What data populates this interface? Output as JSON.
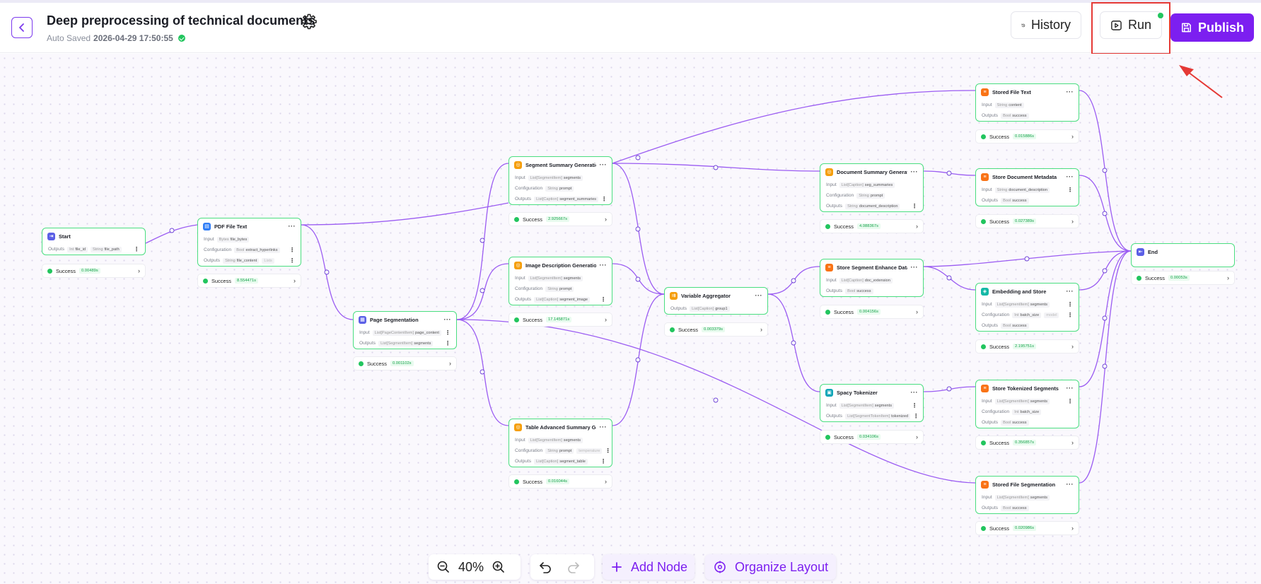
{
  "header": {
    "title": "Deep preprocessing of technical documents",
    "auto_saved_label": "Auto Saved",
    "auto_saved_time": "2026-04-29 17:50:55",
    "history_label": "History",
    "run_label": "Run",
    "publish_label": "Publish"
  },
  "labels": {
    "input": "Input",
    "outputs": "Outputs",
    "configuration": "Configuration",
    "success": "Success"
  },
  "nodes": {
    "start": {
      "title": "Start",
      "out1_type": "Int",
      "out1": "file_id",
      "out2_type": "String",
      "out2": "file_path",
      "duration": "0.00489s"
    },
    "pdf": {
      "title": "PDF File Text",
      "in_type": "Bytes",
      "in": "file_bytes",
      "cfg_type": "Bool",
      "cfg": "extract_hyperlinks",
      "out_type": "String",
      "out": "file_content",
      "out2": "Lists",
      "duration": "8.554471s"
    },
    "page": {
      "title": "Page Segmentation",
      "in_type": "List[PageContentItem]",
      "in": "page_content",
      "out_type": "List[SegmentItem]",
      "out": "segments",
      "duration": "0.001102s"
    },
    "seg_sum": {
      "title": "Segment Summary Generation",
      "in_type": "List[SegmentItem]",
      "in": "segments",
      "cfg_type": "String",
      "cfg": "prompt",
      "out_type": "List[Caption]",
      "out": "segment_summaries",
      "duration": "2.925667s"
    },
    "img": {
      "title": "Image Description Generation",
      "in_type": "List[SegmentItem]",
      "in": "segments",
      "cfg_type": "String",
      "cfg": "prompt",
      "out_type": "List[Caption]",
      "out": "segment_image",
      "duration": "17.145871s"
    },
    "tbl": {
      "title": "Table Advanced Summary Gen...",
      "in_type": "List[SegmentItem]",
      "in": "segments",
      "cfg_type": "String",
      "cfg": "prompt",
      "cfg2": "temperature",
      "out_type": "List[Caption]",
      "out": "segment_table",
      "duration": "0.016044s"
    },
    "var": {
      "title": "Variable Aggregator",
      "out_type": "List[Caption]",
      "out": "group1",
      "duration": "0.003379s"
    },
    "doc_sum": {
      "title": "Document Summary Generation",
      "in_type": "List[Caption]",
      "in": "seg_summaries",
      "cfg_type": "String",
      "cfg": "prompt",
      "out_type": "String",
      "out": "document_description",
      "duration": "4.088367s"
    },
    "store_seg": {
      "title": "Store Segment Enhance Data",
      "in_type": "List[Caption]",
      "in": "doc_extension",
      "out_type": "Bool",
      "out": "success",
      "duration": "0.004156s"
    },
    "spacy": {
      "title": "Spacy Tokenizer",
      "in_type": "List[SegmentItem]",
      "in": "segments",
      "out_type": "List[SegmentTokenItem]",
      "out": "tokenized",
      "duration": "0.034106s"
    },
    "stored_text": {
      "title": "Stored File Text",
      "in_type": "String",
      "in": "content",
      "out_type": "Bool",
      "out": "success",
      "duration": "0.015886s"
    },
    "store_doc": {
      "title": "Store Document Metadata",
      "in_type": "String",
      "in": "document_description",
      "out_type": "Bool",
      "out": "success",
      "duration": "0.027389s"
    },
    "embed": {
      "title": "Embedding and Store",
      "in_type": "List[SegmentItem]",
      "in": "segments",
      "cfg_type": "Int",
      "cfg": "batch_size",
      "cfg2": "model",
      "out_type": "Bool",
      "out": "success",
      "duration": "2.195751s"
    },
    "store_tok": {
      "title": "Store Tokenized Segments",
      "in_type": "List[SegmentItem]",
      "in": "segments",
      "cfg_type": "Int",
      "cfg": "batch_size",
      "out_type": "Bool",
      "out": "success",
      "duration": "0.356857s"
    },
    "stored_seg": {
      "title": "Stored File Segmentation",
      "in_type": "List[SegmentItem]",
      "in": "segments",
      "out_type": "Bool",
      "out": "success",
      "duration": "0.020986s"
    },
    "end": {
      "title": "End",
      "duration": "0.00053s"
    }
  },
  "toolbar": {
    "zoom": "40%",
    "add_node": "Add Node",
    "organize_layout": "Organize Layout"
  },
  "colors": {
    "accent": "#7c1ff0",
    "edge": "#9b5cf2",
    "success": "#22c55e",
    "node_border": "#4ade80",
    "highlight": "#e53935"
  }
}
